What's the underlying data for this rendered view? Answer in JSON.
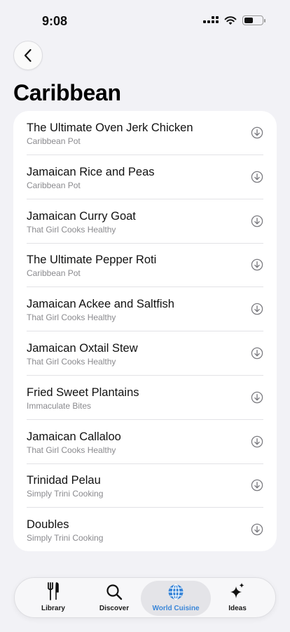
{
  "status_bar": {
    "time": "9:08"
  },
  "header": {
    "title": "Caribbean"
  },
  "recipes": [
    {
      "title": "The Ultimate Oven Jerk Chicken",
      "source": "Caribbean Pot"
    },
    {
      "title": "Jamaican Rice and Peas",
      "source": "Caribbean Pot"
    },
    {
      "title": "Jamaican Curry Goat",
      "source": "That Girl Cooks Healthy"
    },
    {
      "title": "The Ultimate Pepper Roti",
      "source": "Caribbean Pot"
    },
    {
      "title": "Jamaican Ackee and Saltfish",
      "source": "That Girl Cooks Healthy"
    },
    {
      "title": "Jamaican Oxtail Stew",
      "source": "That Girl Cooks Healthy"
    },
    {
      "title": "Fried Sweet Plantains",
      "source": "Immaculate Bites"
    },
    {
      "title": "Jamaican Callaloo",
      "source": "That Girl Cooks Healthy"
    },
    {
      "title": "Trinidad Pelau",
      "source": "Simply Trini Cooking"
    },
    {
      "title": "Doubles",
      "source": "Simply Trini Cooking"
    }
  ],
  "tabs": [
    {
      "label": "Library",
      "icon": "fork-knife-icon",
      "active": false
    },
    {
      "label": "Discover",
      "icon": "search-icon",
      "active": false
    },
    {
      "label": "World Cuisine",
      "icon": "globe-icon",
      "active": true
    },
    {
      "label": "Ideas",
      "icon": "sparkles-icon",
      "active": false
    }
  ],
  "colors": {
    "accent": "#3a86d8",
    "background": "#f2f2f6",
    "card": "#ffffff",
    "secondary_text": "#8a8a8e"
  }
}
